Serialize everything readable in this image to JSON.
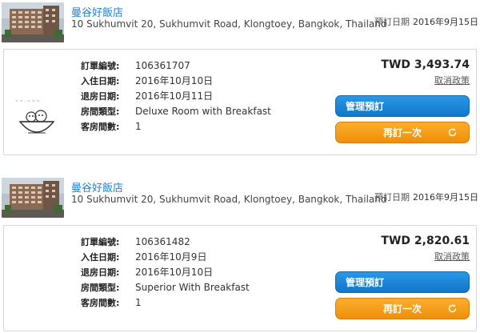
{
  "labels": {
    "booking_date": "預訂日期",
    "order_no": "訂單編號:",
    "checkin": "入住日期:",
    "checkout": "退房日期:",
    "room_type": "房間類型:",
    "room_count": "客房間數:",
    "cancel_policy": "取消政策",
    "manage": "管理預訂",
    "rebook": "再訂一次"
  },
  "bookings": [
    {
      "hotel_name": "曼谷好飯店",
      "address": "10 Sukhumvit 20, Sukhumvit Road, Klongtoey, Bangkok, Thailand",
      "booking_date": "2016年9月15日",
      "order_no": "106361707",
      "checkin": "2016年10月10日",
      "checkout": "2016年10月11日",
      "room_type": "Deluxe Room with Breakfast",
      "room_count": "1",
      "price": "TWD 3,493.74"
    },
    {
      "hotel_name": "曼谷好飯店",
      "address": "10 Sukhumvit 20, Sukhumvit Road, Klongtoey, Bangkok, Thailand",
      "booking_date": "2016年9月15日",
      "order_no": "106361482",
      "checkin": "2016年10月9日",
      "checkout": "2016年10月10日",
      "room_type": "Superior With Breakfast",
      "room_count": "1",
      "price": "TWD 2,820.61"
    }
  ],
  "icons": [
    "hotel-photo",
    "food-doodle-icon",
    "refresh-icon"
  ],
  "colors": {
    "link": "#1a7fd4",
    "manage_button": "#1a86d8",
    "rebook_button": "#f39c12"
  }
}
